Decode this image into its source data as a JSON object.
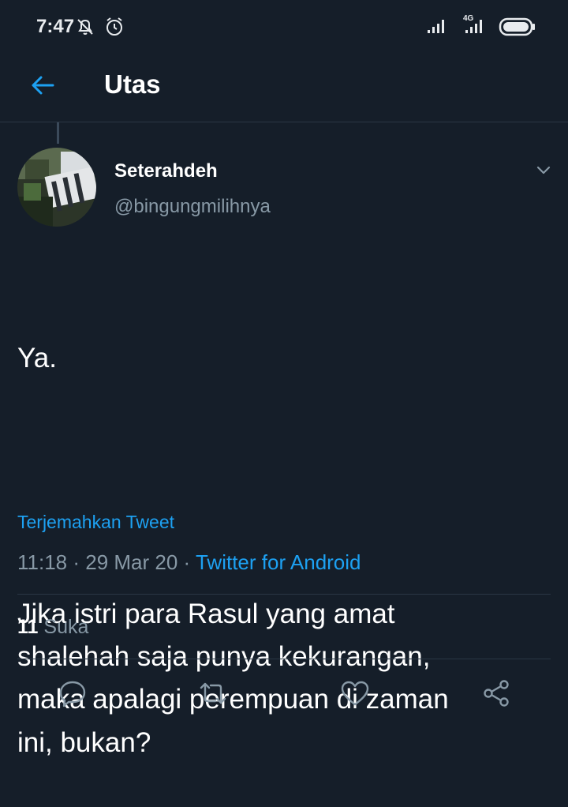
{
  "status_bar": {
    "time": "7:47",
    "network_label": "4G",
    "icons": [
      "notifications-off-icon",
      "alarm-icon",
      "signal-icon",
      "signal-4g-icon",
      "battery-icon"
    ]
  },
  "header": {
    "back_icon": "arrow-left-icon",
    "title": "Utas"
  },
  "tweet": {
    "author_name": "Seterahdeh",
    "author_handle": "@bingungmilihnya",
    "text_line1": "Ya.",
    "text_line2": "Jika istri para Rasul yang amat\nshalehah saja punya kekurangan,\nmaka apalagi perempuan di zaman\nini, bukan?",
    "translate_label": "Terjemahkan Tweet",
    "time": "11:18",
    "separator": " · ",
    "date": "29 Mar 20",
    "source": "Twitter for Android",
    "likes_count": "11",
    "likes_label": "Suka"
  },
  "actions": [
    "reply-icon",
    "retweet-icon",
    "like-icon",
    "share-icon"
  ],
  "colors": {
    "background": "#151e29",
    "accent": "#1da1f2",
    "muted": "#8899a6",
    "divider": "#2a3745"
  }
}
